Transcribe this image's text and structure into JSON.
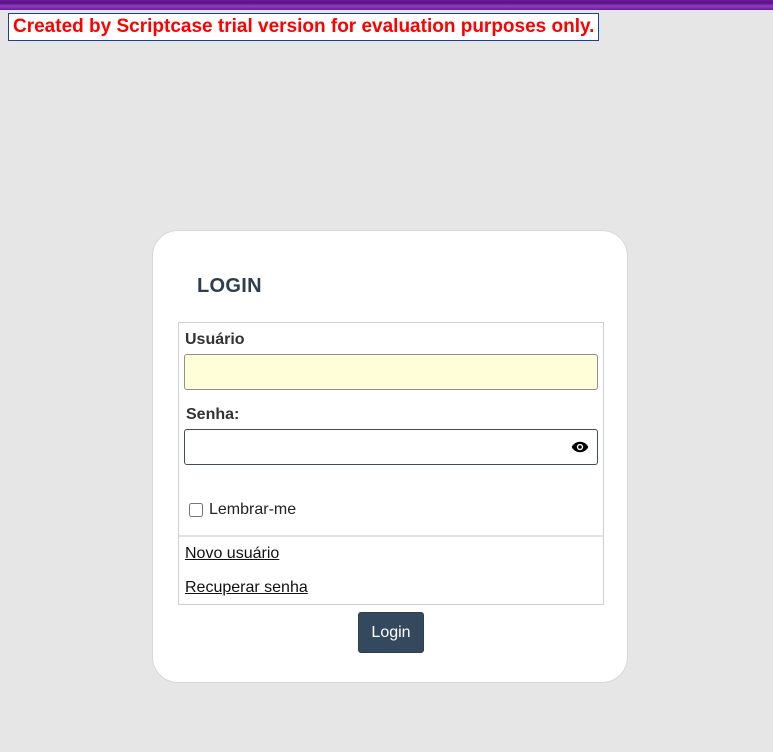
{
  "banner": {
    "text": "Created by Scriptcase trial version for evaluation purposes only."
  },
  "login": {
    "title": "LOGIN",
    "username_label": "Usuário",
    "username_value": "",
    "password_label": "Senha:",
    "password_value": "",
    "remember_label": "Lembrar-me",
    "remember_checked": false,
    "new_user_link": "Novo usuário",
    "recover_link": "Recuperar senha",
    "submit_label": "Login"
  },
  "colors": {
    "background": "#e6e6e6",
    "top_bar": "#6a1b9a",
    "banner_text": "#ff0000",
    "button": "#34495e",
    "username_field_bg": "#fffed8"
  },
  "icons": {
    "password_toggle": "eye-icon"
  }
}
